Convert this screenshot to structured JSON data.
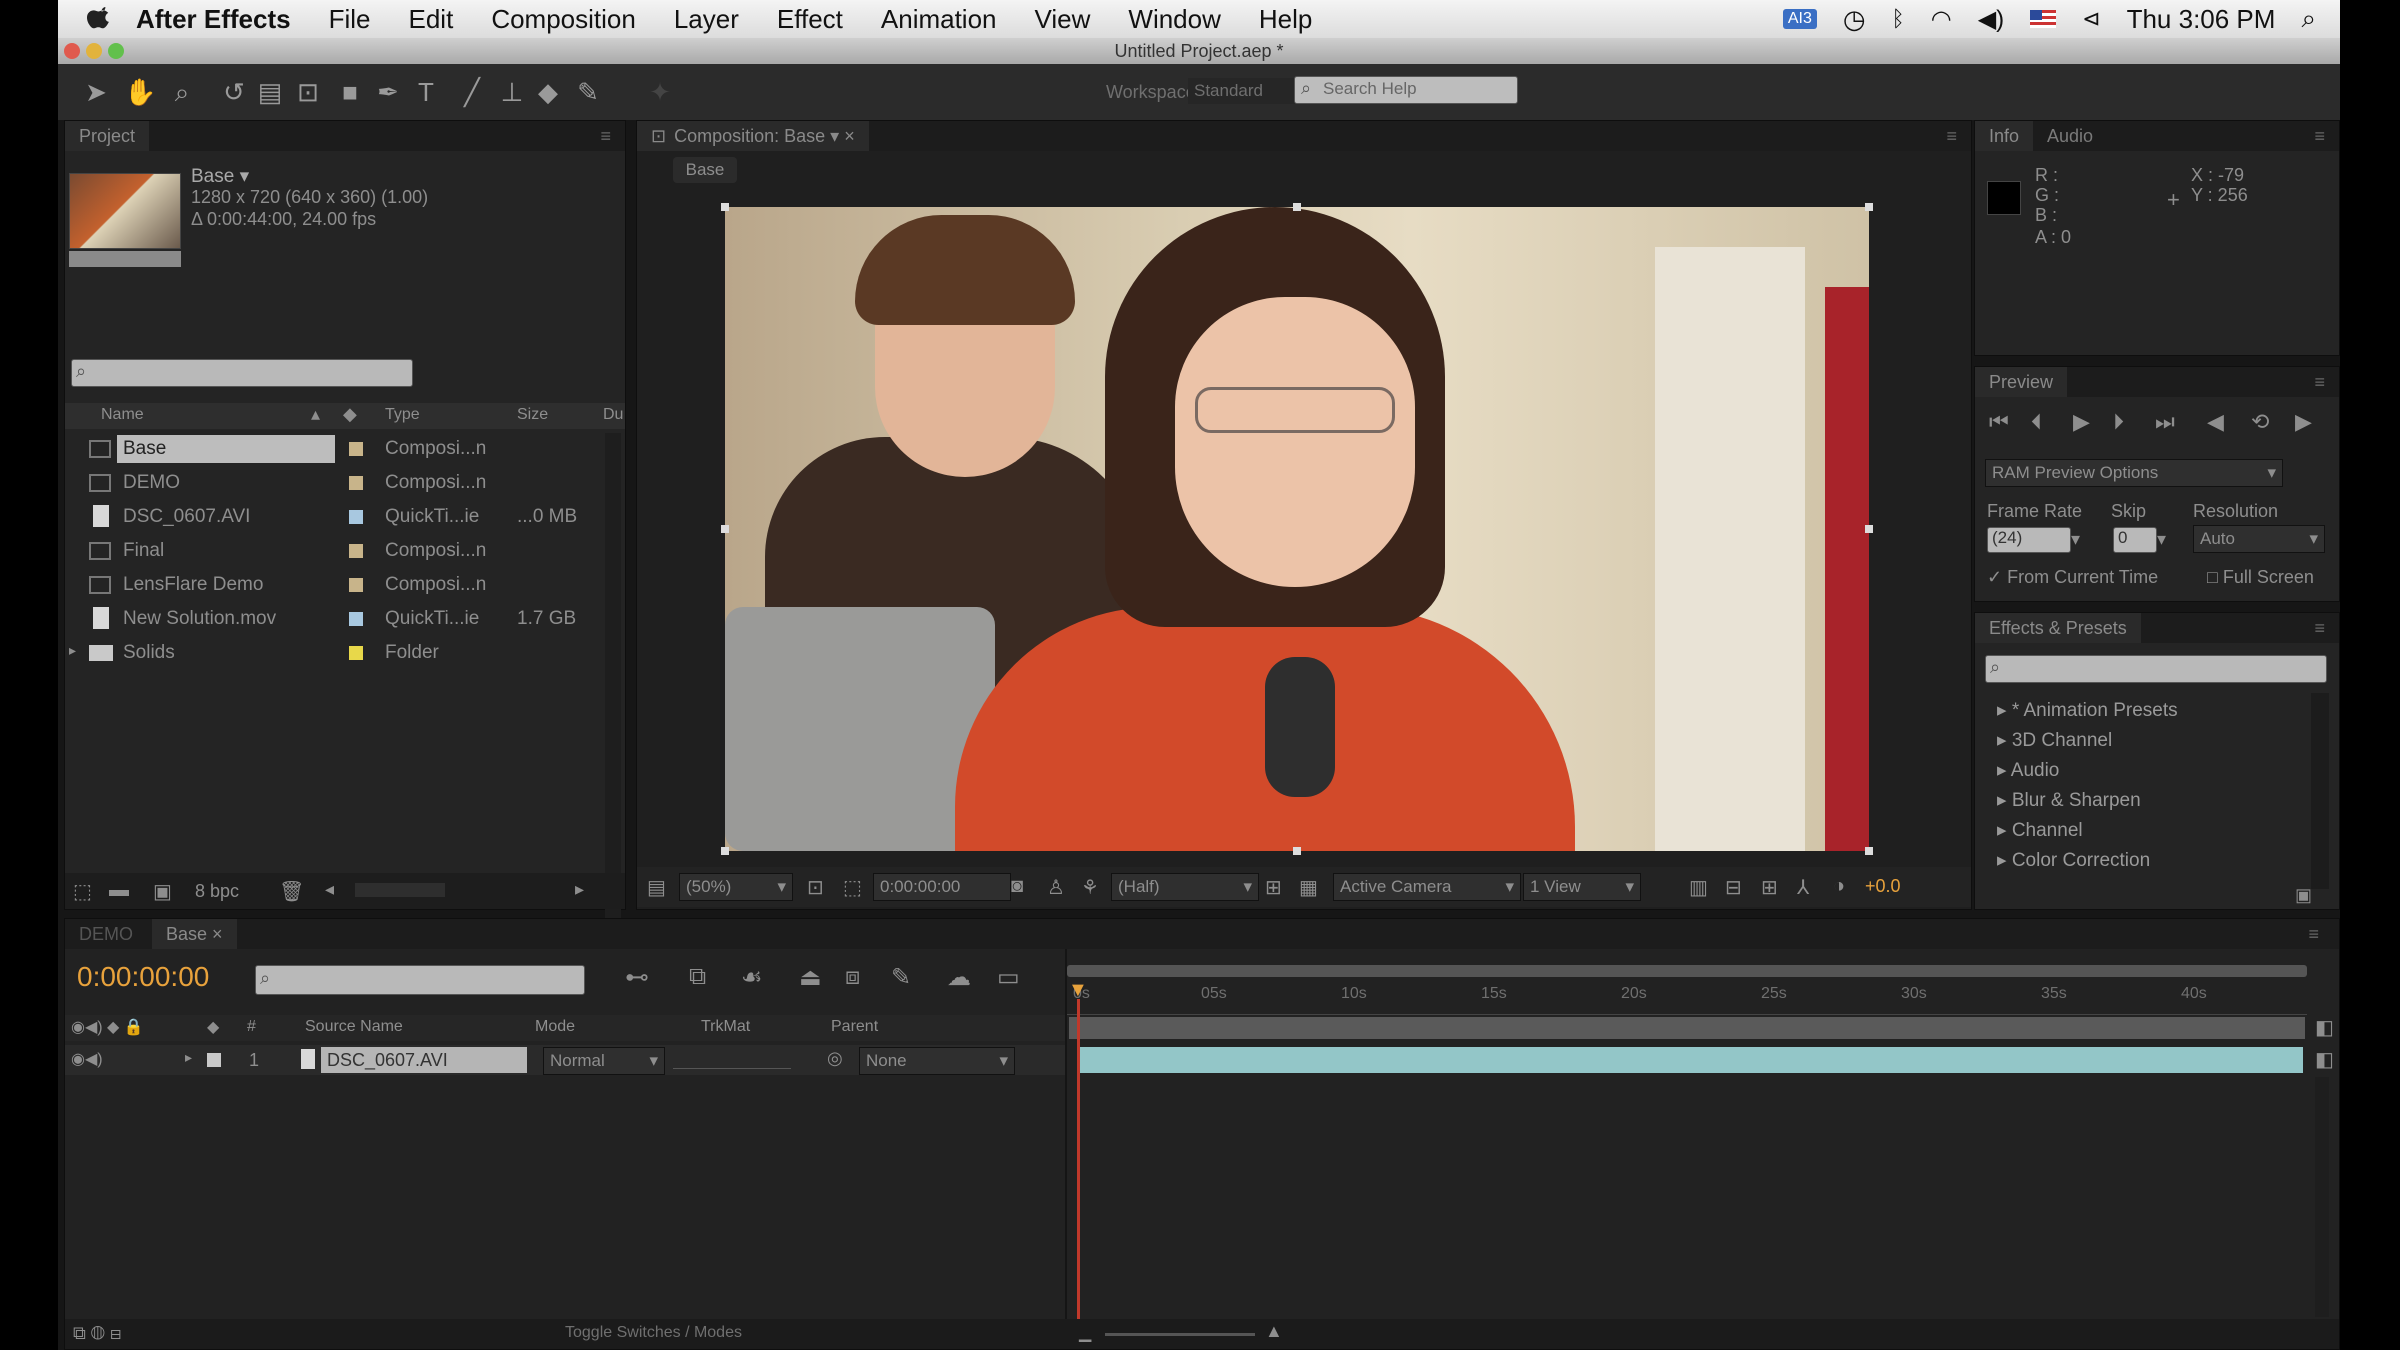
{
  "menubar": {
    "app": "After Effects",
    "items": [
      "File",
      "Edit",
      "Composition",
      "Layer",
      "Effect",
      "Animation",
      "View",
      "Window",
      "Help"
    ],
    "ai_badge": "AI3",
    "clock": "Thu 3:06 PM"
  },
  "window": {
    "title": "Untitled Project.aep *"
  },
  "toolbar": {
    "workspace_label": "Workspace:",
    "workspace_value": "Standard",
    "search_placeholder": "Search Help"
  },
  "project": {
    "tab": "Project",
    "item_name": "Base ▾",
    "item_info1": "1280 x 720  (640 x 360) (1.00)",
    "item_info2": "Δ 0:00:44:00, 24.00 fps",
    "columns": {
      "name": "Name",
      "type": "Type",
      "size": "Size",
      "du": "Du"
    },
    "rows": [
      {
        "name": "Base",
        "type": "Composi...n",
        "size": "",
        "color": "#c8b48a",
        "icon": "composition-icon"
      },
      {
        "name": "DEMO",
        "type": "Composi...n",
        "size": "",
        "color": "#c8b48a",
        "icon": "composition-icon"
      },
      {
        "name": "DSC_0607.AVI",
        "type": "QuickTi...ie",
        "size": "...0 MB",
        "color": "#a8c8e0",
        "icon": "footage-icon"
      },
      {
        "name": "Final",
        "type": "Composi...n",
        "size": "",
        "color": "#c8b48a",
        "icon": "composition-icon"
      },
      {
        "name": "LensFlare Demo",
        "type": "Composi...n",
        "size": "",
        "color": "#c8b48a",
        "icon": "composition-icon"
      },
      {
        "name": "New Solution.mov",
        "type": "QuickTi...ie",
        "size": "1.7 GB",
        "color": "#a8c8e0",
        "icon": "footage-icon"
      },
      {
        "name": "Solids",
        "type": "Folder",
        "size": "",
        "color": "#e8d84a",
        "icon": "folder-icon"
      }
    ],
    "bpc": "8 bpc"
  },
  "composition": {
    "tab": "Composition: Base",
    "breadcrumb": "Base",
    "zoom": "(50%)",
    "timecode": "0:00:00:00",
    "resolution": "(Half)",
    "camera": "Active Camera",
    "views": "1 View",
    "exposure": "+0.0"
  },
  "info": {
    "tab": "Info",
    "tab2": "Audio",
    "r": "R :",
    "g": "G :",
    "b": "B :",
    "a": "A : 0",
    "x": "X : -79",
    "y": "Y : 256"
  },
  "preview": {
    "tab": "Preview",
    "ram_options": "RAM Preview Options",
    "frame_rate_label": "Frame Rate",
    "skip_label": "Skip",
    "resolution_label": "Resolution",
    "frame_rate": "(24)",
    "skip": "0",
    "resolution": "Auto",
    "from_current": "From Current Time",
    "full_screen": "Full Screen"
  },
  "effects": {
    "tab": "Effects & Presets",
    "items": [
      "* Animation Presets",
      "3D Channel",
      "Audio",
      "Blur & Sharpen",
      "Channel",
      "Color Correction"
    ]
  },
  "timeline": {
    "tab1": "DEMO",
    "tab2": "Base",
    "timecode": "0:00:00:00",
    "columns": {
      "num": "#",
      "source": "Source Name",
      "mode": "Mode",
      "trkmat": "TrkMat",
      "parent": "Parent"
    },
    "layer": {
      "num": "1",
      "name": "DSC_0607.AVI",
      "mode": "Normal",
      "parent": "None"
    },
    "ruler": [
      "0s",
      "05s",
      "10s",
      "15s",
      "20s",
      "25s",
      "30s",
      "35s",
      "40s"
    ],
    "toggle": "Toggle Switches / Modes"
  },
  "colors": {
    "accent": "#e8a23c",
    "layer_bar": "#93c6c8",
    "playhead": "#c0392b"
  }
}
